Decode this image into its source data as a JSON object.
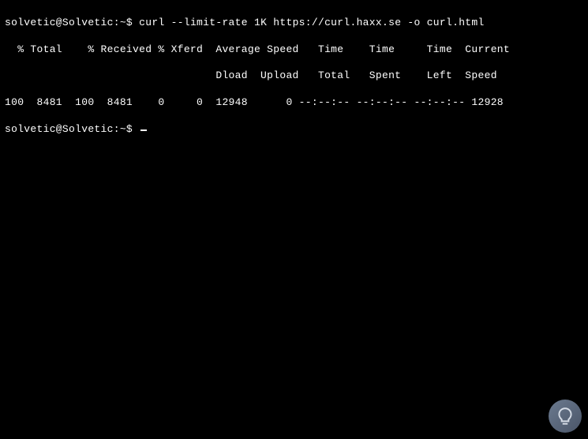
{
  "terminal": {
    "line1": {
      "prompt": "solvetic@Solvetic:~$ ",
      "command": "curl --limit-rate 1K https://curl.haxx.se -o curl.html"
    },
    "header1": "  % Total    % Received % Xferd  Average Speed   Time    Time     Time  Current",
    "header2": "                                 Dload  Upload   Total   Spent    Left  Speed",
    "data": "100  8481  100  8481    0     0  12948      0 --:--:-- --:--:-- --:--:-- 12928",
    "line2": {
      "prompt": "solvetic@Solvetic:~$ "
    }
  }
}
